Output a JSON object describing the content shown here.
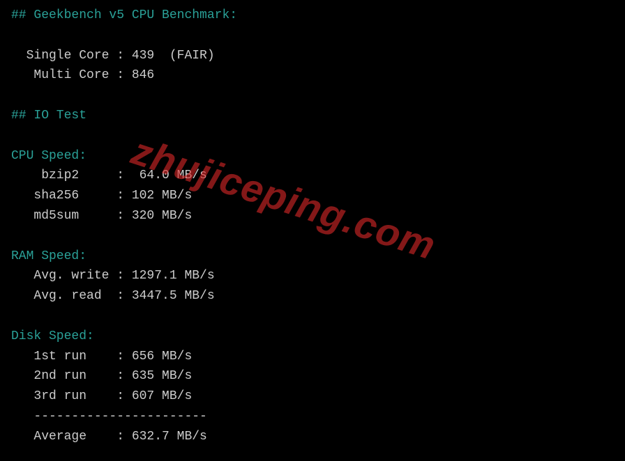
{
  "geekbench": {
    "header": "## Geekbench v5 CPU Benchmark:",
    "single_core_line": "  Single Core : 439  (FAIR)",
    "multi_core_line": "   Multi Core : 846"
  },
  "io_test": {
    "header": "## IO Test"
  },
  "cpu_speed": {
    "label": "CPU Speed:",
    "bzip2_line": "    bzip2     :  64.0 MB/s",
    "sha256_line": "   sha256     : 102 MB/s",
    "md5sum_line": "   md5sum     : 320 MB/s"
  },
  "ram_speed": {
    "label": "RAM Speed:",
    "write_line": "   Avg. write : 1297.1 MB/s",
    "read_line": "   Avg. read  : 3447.5 MB/s"
  },
  "disk_speed": {
    "label": "Disk Speed:",
    "run1_line": "   1st run    : 656 MB/s",
    "run2_line": "   2nd run    : 635 MB/s",
    "run3_line": "   3rd run    : 607 MB/s",
    "divider_line": "   -----------------------",
    "avg_line": "   Average    : 632.7 MB/s"
  },
  "watermark": "zhujiceping.com"
}
